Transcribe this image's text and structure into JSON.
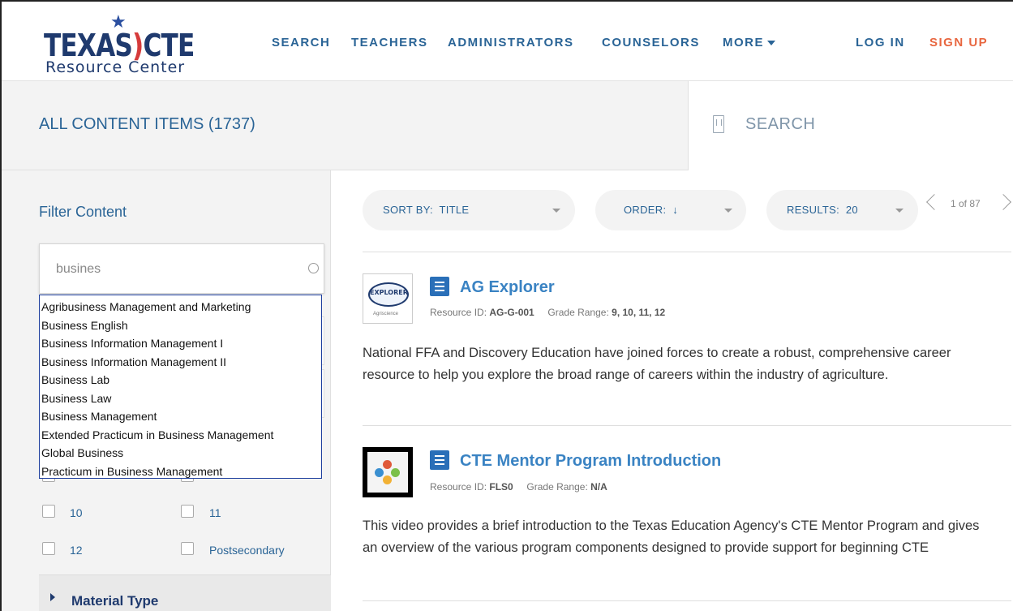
{
  "header": {
    "logo": {
      "main_left": "TEXAS",
      "main_right": "CTE",
      "sub": "Resource Center",
      "star_icon": "star-icon"
    },
    "nav": {
      "search": "SEARCH",
      "teachers": "TEACHERS",
      "administrators": "ADMINISTRATORS",
      "counselors": "COUNSELORS",
      "more": "MORE"
    },
    "login": "LOG IN",
    "signup": "SIGN UP"
  },
  "titlebar": {
    "title": "ALL CONTENT ITEMS (1737)",
    "search_label": "SEARCH"
  },
  "sidebar": {
    "filter_title": "Filter Content",
    "filter_value": "busines",
    "suggestions": [
      "Agribusiness Management and Marketing",
      "Business English",
      "Business Information Management I",
      "Business Information Management II",
      "Business Lab",
      "Business Law",
      "Business Management",
      "Extended Practicum in Business Management",
      "Global Business",
      "Practicum in Business Management"
    ],
    "grades": {
      "g10": "10",
      "g11": "11",
      "g12": "12",
      "post": "Postsecondary"
    },
    "material_type": "Material Type"
  },
  "toolbar": {
    "sort_label": "SORT BY:",
    "sort_value": "TITLE",
    "order_label": "ORDER:",
    "order_value": "↓",
    "results_label": "RESULTS:",
    "results_value": "20",
    "pager": "1 of 87"
  },
  "results": [
    {
      "title": "AG Explorer",
      "resource_id_label": "Resource ID:",
      "resource_id": "AG-G-001",
      "grade_label": "Grade Range:",
      "grade": "9, 10, 11, 12",
      "thumb_text": "EXPLORER",
      "thumb_sub": "Agriscience",
      "description": "National FFA and Discovery Education have joined forces to create a robust, comprehensive career resource to help you explore the broad range of careers within the industry of agriculture."
    },
    {
      "title": "CTE Mentor Program Introduction",
      "resource_id_label": "Resource ID:",
      "resource_id": "FLS0",
      "grade_label": "Grade Range:",
      "grade": "N/A",
      "description": "This video provides a brief introduction to the Texas Education Agency's CTE Mentor Program and gives an overview of the various program components designed to provide support for beginning CTE"
    }
  ],
  "colors": {
    "brand_navy": "#1f3a6e",
    "link_blue": "#2a6496",
    "accent_red": "#d63b3b",
    "signup_orange": "#e8663f",
    "title_blue": "#3a83c3"
  }
}
